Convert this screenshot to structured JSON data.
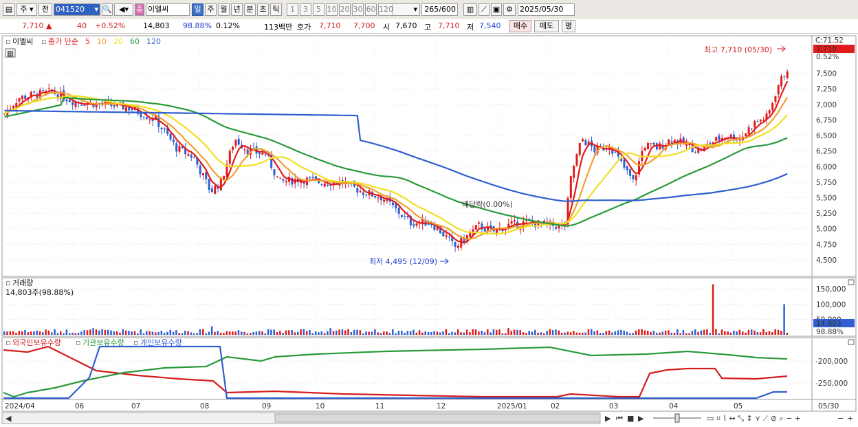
{
  "toolbar": {
    "market": "주",
    "exchange": "전",
    "code": "041520",
    "stock_name": "이엘씨",
    "name_prefix": "종",
    "periods": [
      "일",
      "주",
      "월",
      "년",
      "분",
      "초",
      "틱"
    ],
    "active_period": "일",
    "intervals": [
      "1",
      "3",
      "5",
      "10",
      "20",
      "30",
      "60",
      "120"
    ],
    "count": "265",
    "total": "/600",
    "date": "2025/05/30"
  },
  "quote": {
    "price": "7,710",
    "arrow": "▲",
    "change": "40",
    "change_pct": "+0.52%",
    "volume": "14,803",
    "vol_ratio": "98.88%",
    "turnover": "0.12%",
    "amount": "113백만",
    "ask_label": "호가",
    "ask": "7,710",
    "bid": "7,700",
    "open_label": "시",
    "open": "7,670",
    "high_label": "고",
    "high": "7,710",
    "low_label": "저",
    "low": "7,540",
    "buy_btn": "매수",
    "sell_btn": "매도",
    "eval_btn": "평"
  },
  "legend": {
    "stock": "이엘씨",
    "ma_label": "종가 단순",
    "ma_periods": [
      "5",
      "10",
      "20",
      "60",
      "120"
    ],
    "ma_colors": [
      "#e11b1b",
      "#f0a030",
      "#f0e020",
      "#2a9a3a",
      "#2f5fd0"
    ]
  },
  "annotations": {
    "high": "최고 7,710 (05/30)",
    "low": "최저 4,495 (12/09)",
    "dividend": "배당락(0.00%)"
  },
  "price_axis": {
    "ticks": [
      "7,500",
      "7,250",
      "7,000",
      "6,750",
      "6,500",
      "6,250",
      "6,000",
      "5,750",
      "5,500",
      "5,250",
      "5,000",
      "4,750",
      "4,500"
    ],
    "current": "7,710",
    "current_pct": "0.52%",
    "top_label": "C:71.52"
  },
  "volume_panel": {
    "title": "거래량",
    "value": "14,803주(98.88%)",
    "ticks": [
      "150,000",
      "100,000",
      "50,000"
    ],
    "current": "14,803",
    "current_pct": "98.88%"
  },
  "holding_panel": {
    "foreign": "외국인보유수량",
    "institution": "기관보유수량",
    "individual": "개인보유수량",
    "ticks": [
      "-200,000",
      "-250,000"
    ]
  },
  "x_axis": {
    "labels": [
      "2024/04",
      "06",
      "07",
      "08",
      "09",
      "10",
      "11",
      "12",
      "2025/01",
      "02",
      "03",
      "04",
      "05"
    ],
    "end_label": "05/30"
  },
  "chart_data": {
    "type": "candlestick",
    "y_range": [
      4400,
      7750
    ],
    "ma": [
      {
        "period": "5",
        "values": [
          6900,
          7100,
          7150,
          7050,
          7000,
          6950,
          6850,
          6400,
          6200,
          5700,
          6300,
          6150,
          5800,
          5700,
          5600,
          5550,
          5300,
          5100,
          5000,
          4900,
          4700,
          4900,
          5050,
          5100,
          5050,
          5100,
          6200,
          6300,
          6200,
          5850,
          6200,
          6350,
          6400,
          6300,
          6400,
          6450,
          6600,
          6900,
          7500
        ]
      },
      {
        "period": "10",
        "values": [
          6950,
          7050,
          7100,
          7050,
          7000,
          6950,
          6850,
          6550,
          6300,
          6000,
          6150,
          6100,
          5900,
          5750,
          5650,
          5550,
          5400,
          5200,
          5050,
          4950,
          4850,
          4850,
          5000,
          5050,
          5050,
          5080,
          5800,
          6200,
          6250,
          6000,
          6100,
          6300,
          6350,
          6300,
          6350,
          6450,
          6550,
          6750,
          7250
        ]
      }
    ]
  },
  "colors": {
    "up": "#e11b1b",
    "down": "#2f5fd0",
    "foreign": "#d41c1c",
    "institution": "#2a9a3a",
    "individual": "#2f5fd0"
  }
}
